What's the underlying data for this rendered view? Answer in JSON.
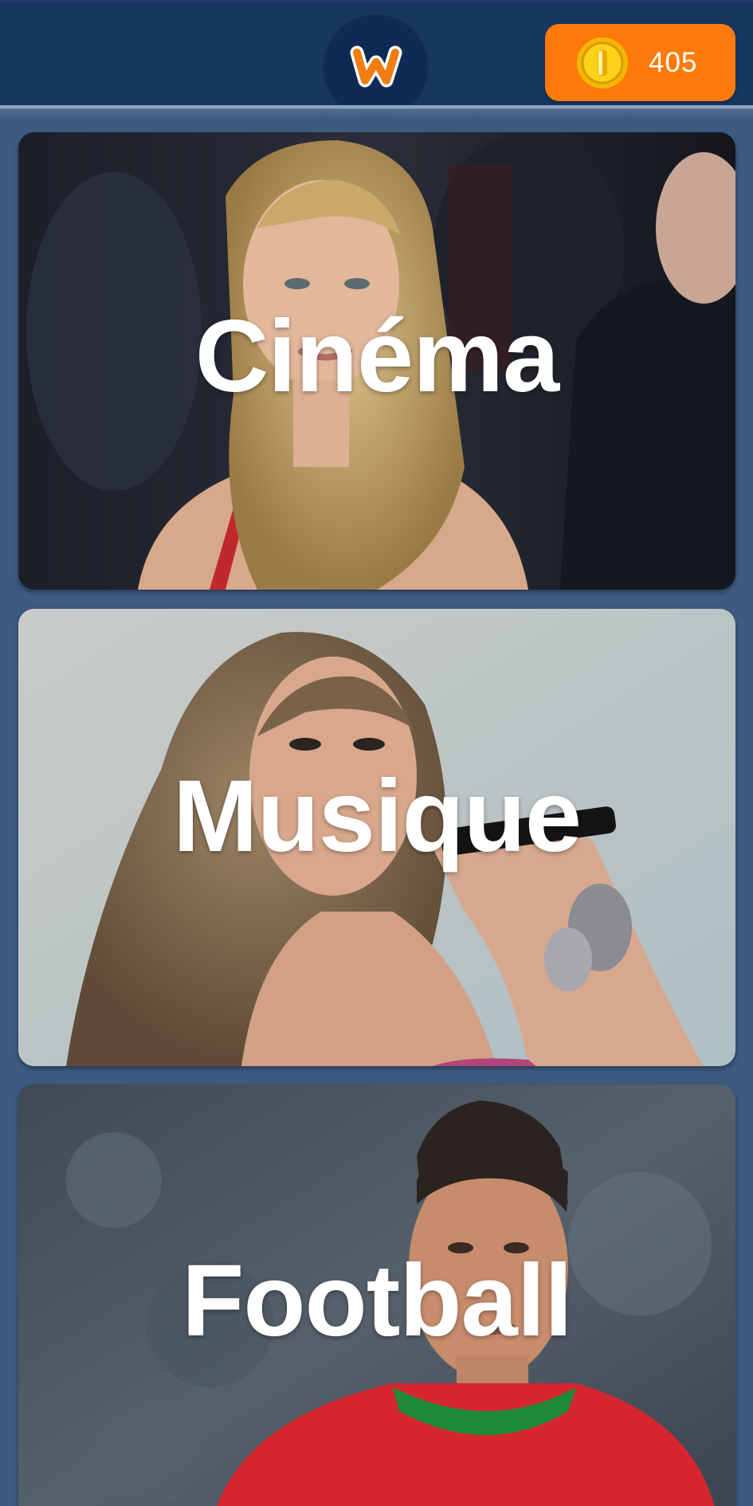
{
  "header": {
    "logo_icon": "w-logo-icon",
    "coins": {
      "icon": "gold-coin-icon",
      "count": "405"
    }
  },
  "categories": [
    {
      "label": "Cinéma"
    },
    {
      "label": "Musique"
    },
    {
      "label": "Football"
    }
  ],
  "colors": {
    "header_background": "#173660",
    "page_background": "#3d5a80",
    "coin_badge": "#ff7a0a",
    "logo_orange": "#f07c12",
    "label_text": "#ffffff"
  }
}
